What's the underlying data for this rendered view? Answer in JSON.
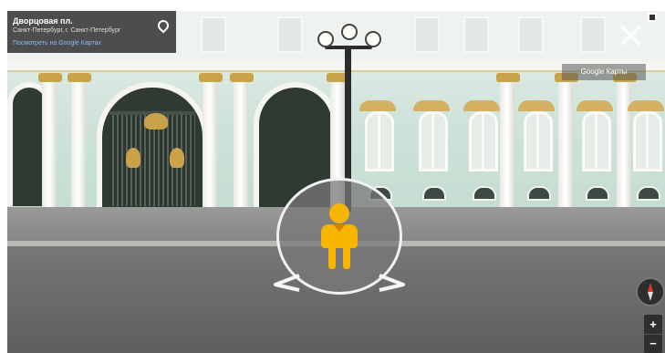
{
  "info_card": {
    "title": "Дворцовая пл.",
    "subtitle": "Санкт-Петербург, г. Санкт-Петербург",
    "link": "Посмотреть на Google Картах"
  },
  "map_link": "Google Карты",
  "zoom": {
    "in": "+",
    "out": "−"
  },
  "icons": [
    "pin-icon",
    "close-icon",
    "expand-icon",
    "pegman-icon",
    "arrow-left-icon",
    "arrow-right-icon",
    "compass-icon"
  ],
  "colors": {
    "pegman": "#f7b500",
    "card_bg": "#282828",
    "link": "#8fb8ff"
  }
}
